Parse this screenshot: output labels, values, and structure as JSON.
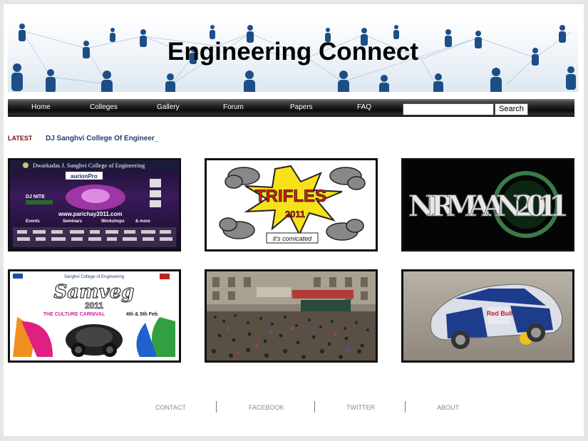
{
  "banner": {
    "title": "Engineering Connect"
  },
  "nav": {
    "items": [
      {
        "label": "Home"
      },
      {
        "label": "Colleges"
      },
      {
        "label": "Gallery"
      },
      {
        "label": "Forum"
      },
      {
        "label": "Papers"
      },
      {
        "label": "FAQ"
      }
    ],
    "search": {
      "value": "",
      "button_label": "Search"
    }
  },
  "latest": {
    "label": "LATEST",
    "text": "DJ Sanghvi College Of Engineer_"
  },
  "gallery": {
    "items": [
      {
        "title": "Dwarkadas J. Sanghvi College of Engineering",
        "sponsor": "aurionPro",
        "event": "DJ NITE",
        "url": "www.parichay2011.com",
        "tags": [
          "Events",
          "Seminars",
          "Workshops",
          "& more"
        ]
      },
      {
        "title": "TRIFLES",
        "year": "2011",
        "tagline": "it's comicated"
      },
      {
        "title": "NIRMAAN 2011"
      },
      {
        "title": "Sanghvi College of Engineering",
        "event": "Samveg",
        "year": "2011",
        "tagline": "THE CULTURE CARNIVAL",
        "dates": "4th & 5th Feb"
      },
      {
        "title": "crowd-photo"
      },
      {
        "title": "Red Bull"
      }
    ]
  },
  "footer": {
    "links": [
      {
        "label": "CONTACT"
      },
      {
        "label": "FACEBOOK"
      },
      {
        "label": "TWITTER"
      },
      {
        "label": "ABOUT"
      }
    ]
  },
  "colors": {
    "nav_bg": "#1a1a1a",
    "latest_label": "#7a1010",
    "latest_text": "#1f3f73",
    "footer_text": "#888888",
    "banner_figure": "#1d4f87"
  }
}
